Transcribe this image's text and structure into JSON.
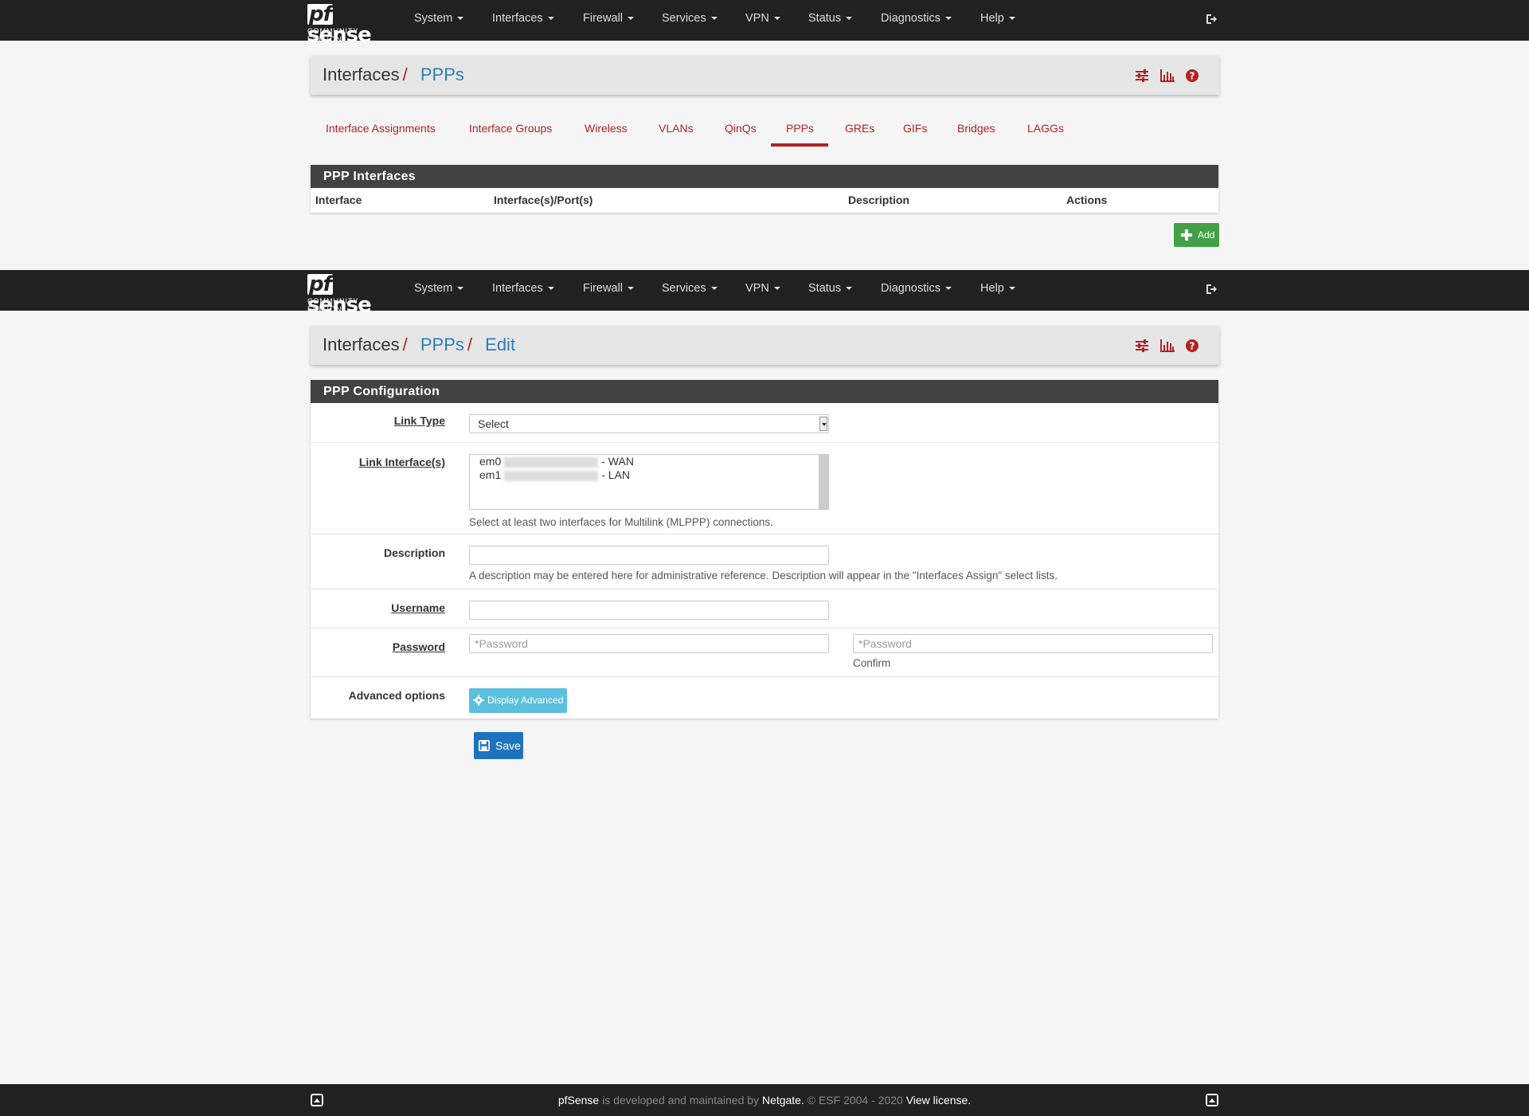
{
  "brand": {
    "name": "pfsense",
    "pf": "pf",
    "rest": "sense",
    "subtitle": "COMMUNITY EDITION"
  },
  "nav": {
    "items": [
      "System",
      "Interfaces",
      "Firewall",
      "Services",
      "VPN",
      "Status",
      "Diagnostics",
      "Help"
    ]
  },
  "page1": {
    "breadcrumb": {
      "root": "Interfaces",
      "current": "PPPs"
    },
    "tabs": [
      "Interface Assignments",
      "Interface Groups",
      "Wireless",
      "VLANs",
      "QinQs",
      "PPPs",
      "GREs",
      "GIFs",
      "Bridges",
      "LAGGs"
    ],
    "active_tab": "PPPs",
    "panel": {
      "title": "PPP Interfaces",
      "columns": [
        "Interface",
        "Interface(s)/Port(s)",
        "Description",
        "Actions"
      ]
    },
    "add_label": "Add"
  },
  "page2": {
    "breadcrumb": {
      "root": "Interfaces",
      "mid": "PPPs",
      "current": "Edit"
    },
    "panel_title": "PPP Configuration",
    "link_type": {
      "label": "Link Type",
      "value": "Select"
    },
    "link_interfaces": {
      "label": "Link Interface(s)",
      "options": [
        {
          "name": "em0",
          "suffix": "- WAN"
        },
        {
          "name": "em1",
          "suffix": "- LAN"
        }
      ],
      "help": "Select at least two interfaces for Multilink (MLPPP) connections."
    },
    "description": {
      "label": "Description",
      "value": "",
      "help": "A description may be entered here for administrative reference. Description will appear in the \"Interfaces Assign\" select lists."
    },
    "username": {
      "label": "Username",
      "value": ""
    },
    "password": {
      "label": "Password",
      "placeholder": "*Password",
      "confirm_placeholder": "*Password",
      "confirm_label": "Confirm"
    },
    "advanced": {
      "label": "Advanced options",
      "button": "Display Advanced"
    },
    "save_label": "Save"
  },
  "footer": {
    "brand": "pfSense",
    "text1": " is developed and maintained by ",
    "company": "Netgate.",
    "text2": " © ESF 2004 - 2020 ",
    "license": "View license."
  },
  "colors": {
    "accent": "#b22222",
    "link": "#2c7fb8",
    "navbar": "#212121",
    "success": "#43a047",
    "info": "#5bc0de",
    "primary": "#1e73be"
  }
}
